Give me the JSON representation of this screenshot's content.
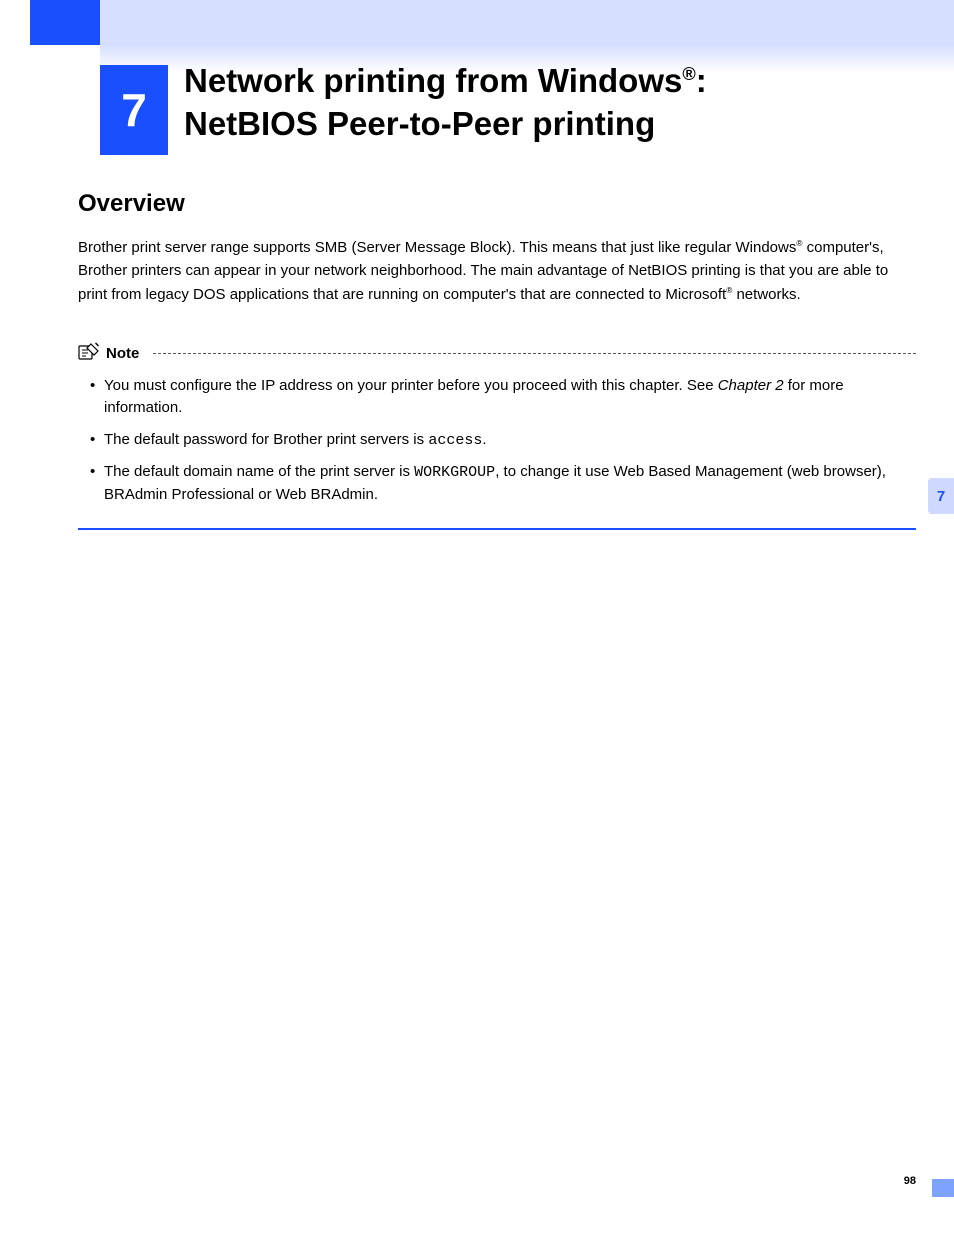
{
  "chapter": {
    "number": "7",
    "title_line1_pre": "Network printing from Windows",
    "title_line1_sup": "®",
    "title_line1_post": ": ",
    "title_line2": "NetBIOS Peer-to-Peer printing"
  },
  "section": {
    "heading": "Overview",
    "paragraph_pre": "Brother print server range supports SMB (Server Message Block). This means that just like regular Windows",
    "paragraph_sup1": "®",
    "paragraph_mid": " computer's, Brother printers can appear in your network neighborhood. The main advantage of NetBIOS printing is that you are able to print from legacy DOS applications that are running on computer's that are connected to Microsoft",
    "paragraph_sup2": "®",
    "paragraph_post": " networks."
  },
  "note": {
    "label": "Note",
    "items": [
      {
        "pre": "You must configure the IP address on your printer before you proceed with this chapter. See ",
        "ref": "Chapter 2",
        "post": " for more information."
      },
      {
        "pre": "The default password for Brother print servers is ",
        "mono": "access",
        "post": "."
      },
      {
        "pre": "The default domain name of the print server is ",
        "mono": "WORKGROUP",
        "post": ", to change it use Web Based Management (web browser), BRAdmin Professional or Web BRAdmin."
      }
    ]
  },
  "sideTab": "7",
  "pageNumber": "98"
}
